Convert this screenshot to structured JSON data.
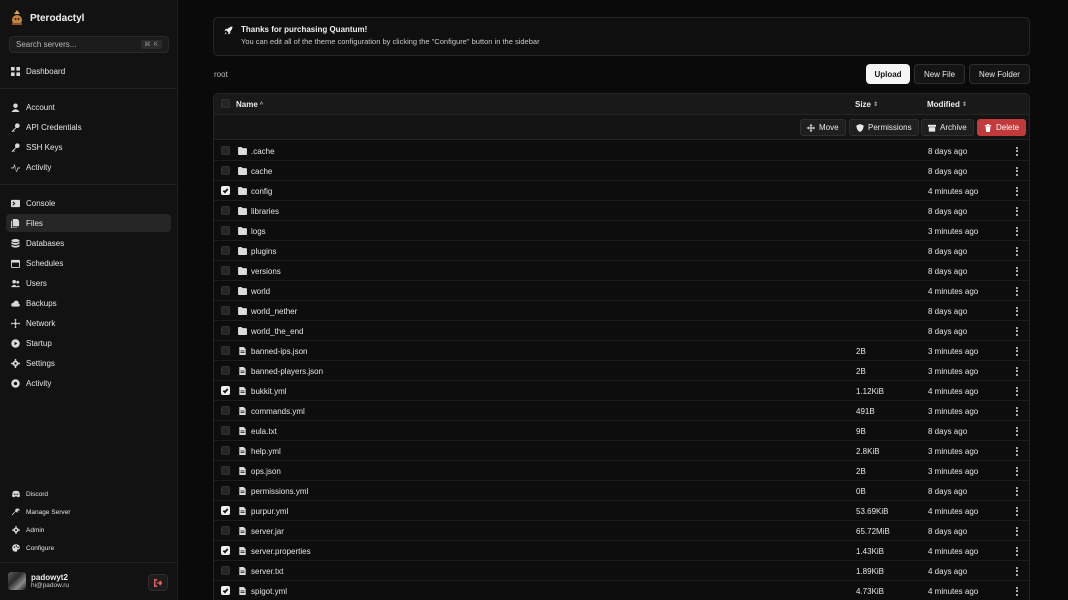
{
  "app": {
    "name": "Pterodactyl"
  },
  "search": {
    "placeholder": "Search servers...",
    "shortcut": "⌘ K"
  },
  "nav": {
    "dashboard": "Dashboard",
    "account_items": [
      {
        "label": "Account",
        "icon": "user-icon"
      },
      {
        "label": "API Credentials",
        "icon": "key-icon"
      },
      {
        "label": "SSH Keys",
        "icon": "key-icon"
      },
      {
        "label": "Activity",
        "icon": "activity-icon"
      }
    ],
    "server_items": [
      {
        "label": "Console",
        "icon": "terminal-icon"
      },
      {
        "label": "Files",
        "icon": "files-icon",
        "active": true
      },
      {
        "label": "Databases",
        "icon": "database-icon"
      },
      {
        "label": "Schedules",
        "icon": "calendar-icon"
      },
      {
        "label": "Users",
        "icon": "users-icon"
      },
      {
        "label": "Backups",
        "icon": "cloud-icon"
      },
      {
        "label": "Network",
        "icon": "network-icon"
      },
      {
        "label": "Startup",
        "icon": "play-icon"
      },
      {
        "label": "Settings",
        "icon": "gear-icon"
      },
      {
        "label": "Activity",
        "icon": "eye-icon"
      }
    ],
    "footer_items": [
      {
        "label": "Discord",
        "icon": "discord-icon"
      },
      {
        "label": "Manage Server",
        "icon": "wrench-icon"
      },
      {
        "label": "Admin",
        "icon": "gear-icon"
      },
      {
        "label": "Configure",
        "icon": "palette-icon"
      }
    ]
  },
  "user": {
    "name": "padowyt2",
    "email": "hi@padow.ru"
  },
  "banner": {
    "title": "Thanks for purchasing Quantum!",
    "text": "You can edit all of the theme configuration by clicking the \"Configure\" button in the sidebar"
  },
  "breadcrumb": "root",
  "toolbar": {
    "upload": "Upload",
    "new_file": "New File",
    "new_folder": "New Folder"
  },
  "table": {
    "headers": {
      "name": "Name",
      "size": "Size",
      "modified": "Modified"
    },
    "actions": {
      "move": "Move",
      "permissions": "Permissions",
      "archive": "Archive",
      "delete": "Delete"
    },
    "rows": [
      {
        "type": "folder",
        "name": ".cache",
        "size": "",
        "modified": "8 days ago",
        "checked": false
      },
      {
        "type": "folder",
        "name": "cache",
        "size": "",
        "modified": "8 days ago",
        "checked": false
      },
      {
        "type": "folder",
        "name": "config",
        "size": "",
        "modified": "4 minutes ago",
        "checked": true
      },
      {
        "type": "folder",
        "name": "libraries",
        "size": "",
        "modified": "8 days ago",
        "checked": false
      },
      {
        "type": "folder",
        "name": "logs",
        "size": "",
        "modified": "3 minutes ago",
        "checked": false
      },
      {
        "type": "folder",
        "name": "plugins",
        "size": "",
        "modified": "8 days ago",
        "checked": false
      },
      {
        "type": "folder",
        "name": "versions",
        "size": "",
        "modified": "8 days ago",
        "checked": false
      },
      {
        "type": "folder",
        "name": "world",
        "size": "",
        "modified": "4 minutes ago",
        "checked": false
      },
      {
        "type": "folder",
        "name": "world_nether",
        "size": "",
        "modified": "8 days ago",
        "checked": false
      },
      {
        "type": "folder",
        "name": "world_the_end",
        "size": "",
        "modified": "8 days ago",
        "checked": false
      },
      {
        "type": "file",
        "name": "banned-ips.json",
        "size": "2B",
        "modified": "3 minutes ago",
        "checked": false
      },
      {
        "type": "file",
        "name": "banned-players.json",
        "size": "2B",
        "modified": "3 minutes ago",
        "checked": false
      },
      {
        "type": "file",
        "name": "bukkit.yml",
        "size": "1.12KiB",
        "modified": "4 minutes ago",
        "checked": true
      },
      {
        "type": "file",
        "name": "commands.yml",
        "size": "491B",
        "modified": "3 minutes ago",
        "checked": false
      },
      {
        "type": "file",
        "name": "eula.txt",
        "size": "9B",
        "modified": "8 days ago",
        "checked": false
      },
      {
        "type": "file",
        "name": "help.yml",
        "size": "2.8KiB",
        "modified": "3 minutes ago",
        "checked": false
      },
      {
        "type": "file",
        "name": "ops.json",
        "size": "2B",
        "modified": "3 minutes ago",
        "checked": false
      },
      {
        "type": "file",
        "name": "permissions.yml",
        "size": "0B",
        "modified": "8 days ago",
        "checked": false
      },
      {
        "type": "file",
        "name": "purpur.yml",
        "size": "53.69KiB",
        "modified": "4 minutes ago",
        "checked": true
      },
      {
        "type": "file",
        "name": "server.jar",
        "size": "65.72MiB",
        "modified": "8 days ago",
        "checked": false
      },
      {
        "type": "file",
        "name": "server.properties",
        "size": "1.43KiB",
        "modified": "4 minutes ago",
        "checked": true
      },
      {
        "type": "file",
        "name": "server.txt",
        "size": "1.89KiB",
        "modified": "4 days ago",
        "checked": false
      },
      {
        "type": "file",
        "name": "spigot.yml",
        "size": "4.73KiB",
        "modified": "4 minutes ago",
        "checked": true
      }
    ]
  }
}
